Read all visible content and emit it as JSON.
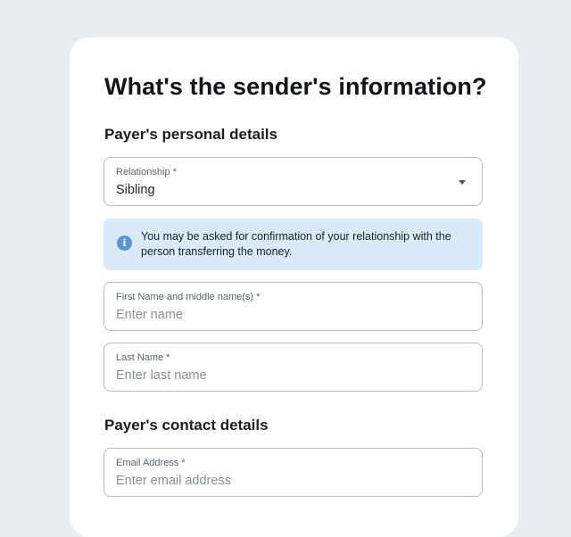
{
  "page": {
    "title": "What's the sender's information?"
  },
  "personal_section": {
    "heading": "Payer's personal details",
    "relationship": {
      "label": "Relationship *",
      "value": "Sibling"
    },
    "notice": {
      "icon": "info-icon",
      "text": "You may be asked for confirmation of your relationship with the person transferring the money."
    },
    "first_name": {
      "label": "First Name and middle name(s) *",
      "placeholder": "Enter name",
      "value": ""
    },
    "last_name": {
      "label": "Last Name *",
      "placeholder": "Enter last name",
      "value": ""
    }
  },
  "contact_section": {
    "heading": "Payer's contact details",
    "email": {
      "label": "Email Address *",
      "placeholder": "Enter email address",
      "value": ""
    }
  },
  "colors": {
    "background": "#e9edf1",
    "card": "#ffffff",
    "notice_bg": "#d9ebfa",
    "info_icon": "#5a96d4",
    "field_border": "#b9bec6"
  }
}
